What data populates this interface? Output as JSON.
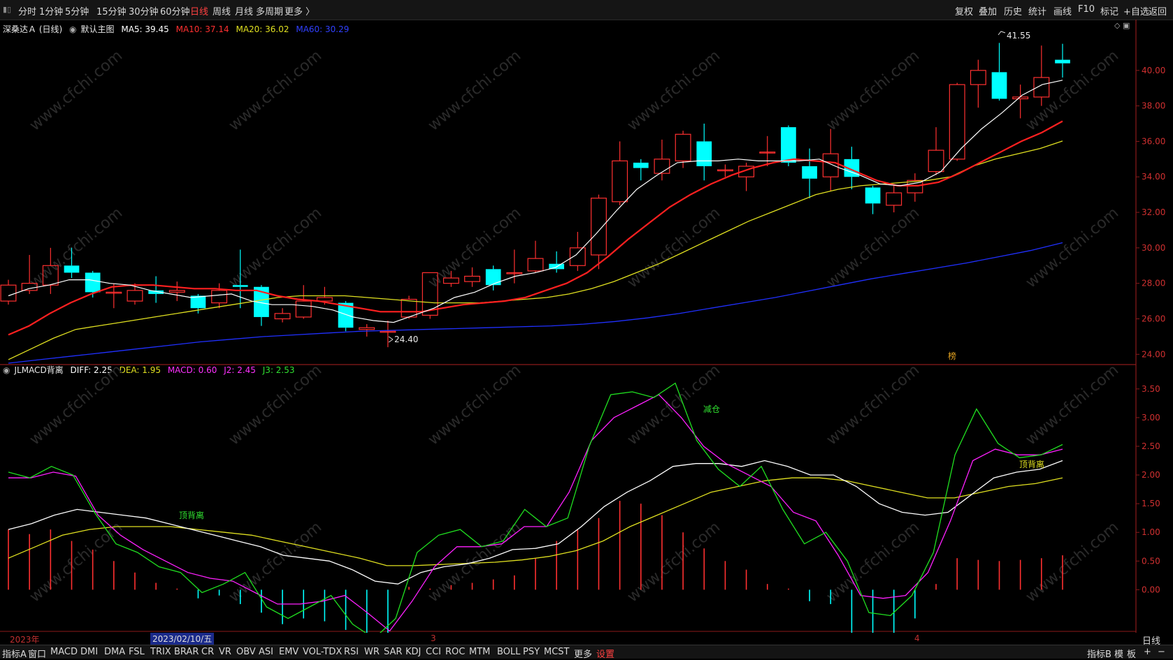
{
  "topbar": {
    "left_items": [
      "分时",
      "1分钟",
      "5分钟",
      "15分钟",
      "30分钟",
      "60分钟",
      "日线",
      "周线",
      "月线",
      "多周期",
      "更多 〉"
    ],
    "active": "日线",
    "right_items": [
      "复权",
      "叠加",
      "历史",
      "统计",
      "画线",
      "F10",
      "标记",
      "+自选",
      "返回"
    ]
  },
  "main_legend": {
    "stock": "深桑达Ａ (日线)",
    "template": "默认主图",
    "ma5": "MA5: 39.45",
    "ma10": "MA10: 37.14",
    "ma20": "MA20: 36.02",
    "ma60": "MA60: 30.29"
  },
  "sub_legend": {
    "name": "JLMACD背离",
    "diff": "DIFF: 2.25",
    "dea": "DEA: 1.95",
    "macd": "MACD: 0.60",
    "j2": "J2: 2.45",
    "j3": "J3: 2.53"
  },
  "main_axis": [
    "40.00",
    "38.00",
    "36.00",
    "34.00",
    "32.00",
    "30.00",
    "28.00",
    "26.00",
    "24.00"
  ],
  "sub_axis": [
    "3.50",
    "3.00",
    "2.50",
    "2.00",
    "1.50",
    "1.00",
    "0.50",
    "0.00"
  ],
  "annotations": {
    "high": "41.55",
    "low": "24.40",
    "jiancang": "减仓",
    "dingbeili_you": "顶背离",
    "dingbeili_left": "顶背离",
    "marker": "榜"
  },
  "watermark": "www.cfchi.com",
  "datebar": {
    "year": "2023年",
    "selected": "2023/02/10/五",
    "m3": "3",
    "m4": "4"
  },
  "period_label": "日线",
  "bottombar": {
    "left_items": [
      "指标A",
      "窗口",
      "MACD",
      "DMI",
      "DMA",
      "FSL",
      "TRIX",
      "BRAR",
      "CR",
      "VR",
      "OBV",
      "ASI",
      "EMV",
      "VOL-TDX",
      "RSI",
      "WR",
      "SAR",
      "KDJ",
      "CCI",
      "ROC",
      "MTM",
      "BOLL",
      "PSY",
      "MCST",
      "更多",
      "设置"
    ],
    "active": "设置",
    "right_items": [
      "指标B",
      "模",
      "板",
      "+",
      "−"
    ]
  },
  "colors": {
    "up": "#ff3030",
    "down": "#00ffff",
    "ma5": "#ffffff",
    "ma10": "#ff2020",
    "ma20": "#e0e020",
    "ma60": "#2030ff",
    "diff": "#ffffff",
    "dea": "#e0e020",
    "j2": "#ff20ff",
    "j3": "#20e020",
    "grid": "#8b1a1a"
  },
  "chart_data": {
    "type": "candlestick",
    "ylim_main": [
      23.5,
      42.0
    ],
    "ylim_sub": [
      -0.75,
      3.9
    ],
    "candles": [
      [
        27.0,
        27.9,
        28.2,
        26.8
      ],
      [
        27.6,
        28.0,
        29.6,
        27.4
      ],
      [
        27.9,
        29.0,
        30.0,
        27.4
      ],
      [
        29.0,
        28.6,
        30.0,
        28.3
      ],
      [
        28.6,
        27.5,
        28.7,
        27.2
      ],
      [
        27.5,
        27.5,
        28.0,
        26.6
      ],
      [
        27.0,
        27.6,
        28.0,
        26.8
      ],
      [
        27.6,
        27.4,
        28.4,
        26.9
      ],
      [
        27.5,
        27.6,
        28.1,
        27.0
      ],
      [
        27.3,
        26.6,
        27.4,
        26.3
      ],
      [
        26.9,
        27.6,
        28.0,
        26.6
      ],
      [
        27.9,
        27.8,
        29.9,
        26.6
      ],
      [
        27.8,
        26.1,
        27.9,
        25.6
      ],
      [
        26.0,
        26.3,
        26.6,
        25.8
      ],
      [
        26.1,
        27.0,
        27.9,
        26.0
      ],
      [
        27.0,
        27.2,
        27.8,
        26.8
      ],
      [
        26.9,
        25.5,
        27.0,
        25.3
      ],
      [
        25.4,
        25.5,
        25.7,
        25.0
      ],
      [
        25.3,
        25.3,
        25.9,
        24.4
      ],
      [
        26.1,
        27.1,
        27.3,
        26.0
      ],
      [
        26.2,
        28.6,
        28.6,
        26.0
      ],
      [
        28.0,
        28.3,
        28.7,
        27.8
      ],
      [
        28.1,
        28.4,
        28.9,
        27.8
      ],
      [
        28.8,
        27.9,
        29.0,
        27.6
      ],
      [
        28.6,
        28.6,
        29.9,
        28.0
      ],
      [
        28.7,
        29.4,
        30.4,
        28.6
      ],
      [
        29.1,
        28.8,
        29.8,
        28.6
      ],
      [
        29.0,
        30.0,
        30.9,
        28.7
      ],
      [
        29.6,
        32.8,
        33.0,
        28.8
      ],
      [
        32.6,
        34.9,
        36.0,
        32.4
      ],
      [
        34.8,
        34.5,
        35.0,
        33.8
      ],
      [
        34.2,
        35.0,
        36.1,
        33.8
      ],
      [
        34.9,
        36.4,
        36.6,
        34.5
      ],
      [
        36.0,
        34.6,
        37.0,
        33.8
      ],
      [
        34.4,
        34.4,
        34.7,
        34.0
      ],
      [
        34.0,
        34.6,
        34.8,
        33.2
      ],
      [
        35.4,
        35.4,
        36.3,
        34.6
      ],
      [
        36.8,
        34.8,
        36.9,
        34.6
      ],
      [
        34.6,
        33.9,
        35.6,
        32.8
      ],
      [
        34.0,
        35.3,
        36.7,
        33.2
      ],
      [
        35.0,
        34.0,
        35.7,
        33.3
      ],
      [
        33.4,
        32.5,
        33.5,
        31.9
      ],
      [
        32.4,
        33.1,
        33.6,
        32.0
      ],
      [
        33.1,
        33.8,
        34.2,
        32.6
      ],
      [
        34.3,
        35.5,
        36.8,
        34.1
      ],
      [
        35.0,
        39.2,
        39.3,
        34.9
      ],
      [
        39.2,
        40.0,
        40.6,
        37.9
      ],
      [
        39.9,
        38.4,
        41.55,
        38.3
      ],
      [
        38.4,
        38.5,
        39.2,
        37.3
      ],
      [
        38.5,
        39.6,
        41.4,
        38.0
      ],
      [
        40.6,
        40.4,
        41.5,
        39.6
      ]
    ],
    "ma5": [
      27.3,
      27.7,
      27.9,
      28.2,
      28.2,
      28.0,
      27.9,
      27.6,
      27.4,
      27.2,
      27.3,
      27.4,
      27.0,
      26.8,
      26.8,
      26.7,
      26.5,
      26.1,
      25.9,
      25.8,
      26.2,
      26.6,
      27.2,
      27.5,
      28.0,
      28.4,
      28.6,
      28.9,
      29.6,
      30.8,
      32.1,
      33.3,
      34.1,
      34.8,
      34.9,
      34.9,
      35.0,
      34.9,
      34.9,
      34.9,
      35.0,
      34.5,
      34.1,
      33.6,
      33.5,
      33.7,
      34.3,
      35.6,
      36.7,
      37.6,
      38.6,
      39.2,
      39.45
    ],
    "ma10": [
      25.1,
      25.6,
      26.3,
      26.9,
      27.4,
      27.8,
      27.9,
      27.9,
      27.8,
      27.7,
      27.7,
      27.6,
      27.6,
      27.3,
      27.1,
      27.0,
      26.8,
      26.6,
      26.4,
      26.4,
      26.4,
      26.6,
      26.8,
      26.9,
      27.0,
      27.2,
      27.6,
      28.0,
      28.6,
      29.5,
      30.5,
      31.4,
      32.3,
      33.0,
      33.6,
      34.1,
      34.5,
      34.8,
      35.0,
      34.9,
      34.8,
      34.3,
      33.8,
      33.5,
      33.5,
      33.7,
      34.2,
      34.8,
      35.4,
      36.0,
      36.5,
      37.14
    ],
    "ma20": [
      23.7,
      24.3,
      24.9,
      25.4,
      25.6,
      25.8,
      26.0,
      26.2,
      26.4,
      26.6,
      26.8,
      27.0,
      27.2,
      27.3,
      27.3,
      27.3,
      27.2,
      27.1,
      27.0,
      26.9,
      26.9,
      26.9,
      27.0,
      27.1,
      27.2,
      27.4,
      27.7,
      28.1,
      28.6,
      29.1,
      29.7,
      30.3,
      30.9,
      31.5,
      32.0,
      32.5,
      33.0,
      33.3,
      33.5,
      33.6,
      33.7,
      33.8,
      34.0,
      34.6,
      35.0,
      35.3,
      35.6,
      36.02
    ],
    "ma60": [
      23.5,
      23.7,
      23.9,
      24.1,
      24.3,
      24.5,
      24.7,
      24.85,
      25.0,
      25.1,
      25.2,
      25.3,
      25.35,
      25.4,
      25.45,
      25.5,
      25.55,
      25.6,
      25.7,
      25.85,
      26.05,
      26.3,
      26.6,
      26.9,
      27.2,
      27.55,
      27.9,
      28.25,
      28.55,
      28.85,
      29.15,
      29.5,
      29.85,
      30.29
    ],
    "diff": [
      1.05,
      1.15,
      1.3,
      1.4,
      1.35,
      1.3,
      1.25,
      1.15,
      1.05,
      0.95,
      0.85,
      0.75,
      0.6,
      0.55,
      0.5,
      0.35,
      0.15,
      0.1,
      0.3,
      0.4,
      0.45,
      0.55,
      0.7,
      0.72,
      0.8,
      1.1,
      1.45,
      1.7,
      1.9,
      2.15,
      2.2,
      2.2,
      2.15,
      2.25,
      2.15,
      2.0,
      2.0,
      1.8,
      1.5,
      1.35,
      1.3,
      1.35,
      1.65,
      1.95,
      2.05,
      2.1,
      2.25
    ],
    "dea": [
      0.55,
      0.75,
      0.95,
      1.05,
      1.1,
      1.1,
      1.1,
      1.05,
      1.0,
      0.95,
      0.85,
      0.75,
      0.65,
      0.55,
      0.42,
      0.42,
      0.44,
      0.46,
      0.48,
      0.52,
      0.58,
      0.68,
      0.85,
      1.1,
      1.3,
      1.5,
      1.7,
      1.8,
      1.9,
      1.95,
      1.95,
      1.9,
      1.8,
      1.7,
      1.6,
      1.6,
      1.7,
      1.8,
      1.85,
      1.95
    ],
    "j2": [
      1.95,
      1.95,
      2.05,
      1.98,
      1.3,
      0.95,
      0.7,
      0.5,
      0.3,
      0.2,
      0.15,
      -0.05,
      -0.25,
      -0.25,
      -0.2,
      -0.1,
      -0.4,
      -0.72,
      -0.2,
      0.4,
      0.75,
      0.75,
      0.8,
      1.1,
      1.1,
      1.7,
      2.6,
      3.0,
      3.2,
      3.4,
      3.0,
      2.5,
      2.2,
      2.0,
      1.8,
      1.35,
      1.2,
      0.6,
      -0.1,
      -0.15,
      -0.1,
      0.3,
      1.2,
      2.25,
      2.45,
      2.35,
      2.35,
      2.45
    ],
    "j3": [
      2.05,
      1.95,
      2.15,
      2.0,
      1.35,
      0.8,
      0.65,
      0.4,
      0.3,
      -0.05,
      0.1,
      0.3,
      -0.3,
      -0.5,
      -0.3,
      -0.1,
      -0.6,
      -0.85,
      -0.5,
      0.65,
      0.95,
      1.05,
      0.75,
      0.85,
      1.4,
      1.1,
      1.25,
      2.5,
      3.4,
      3.45,
      3.35,
      3.6,
      2.6,
      2.1,
      1.8,
      2.15,
      1.4,
      0.8,
      1.0,
      0.5,
      -0.4,
      -0.45,
      -0.1,
      0.65,
      2.35,
      3.15,
      2.55,
      2.3,
      2.35,
      2.53
    ],
    "macd_bars": [
      1.05,
      0.97,
      1.05,
      0.85,
      0.7,
      0.5,
      0.3,
      0.12,
      0.02,
      -0.15,
      -0.1,
      -0.25,
      -0.4,
      -0.6,
      -0.5,
      -0.55,
      -0.7,
      -0.88,
      -0.75,
      0.05,
      0.02,
      0.08,
      0.12,
      0.18,
      0.25,
      0.55,
      0.85,
      1.05,
      1.25,
      1.55,
      1.5,
      1.3,
      1.0,
      0.72,
      0.5,
      0.35,
      0.1,
      0.02,
      -0.2,
      -0.25,
      -0.75,
      -0.8,
      -0.75,
      -0.5,
      0.1,
      0.55,
      0.52,
      0.5,
      0.52,
      0.55,
      0.6
    ]
  }
}
